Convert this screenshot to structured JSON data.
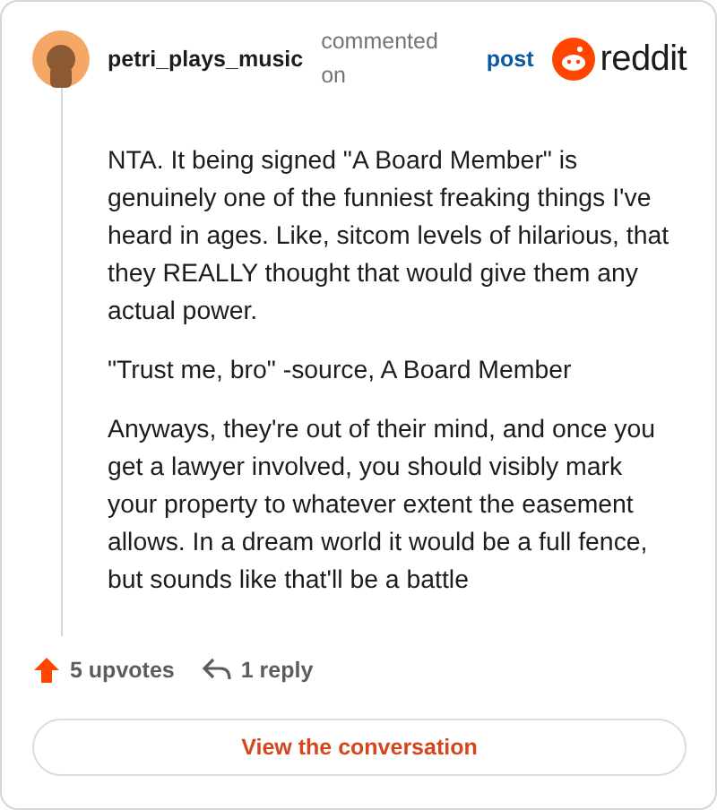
{
  "header": {
    "username": "petri_plays_music",
    "action": "commented on",
    "link": "post",
    "logo_text": "reddit"
  },
  "comment": {
    "paragraphs": [
      "NTA. It being signed \"A Board Member\" is genuinely one of the funniest freaking things I've heard in ages. Like, sitcom levels of hilarious, that they REALLY thought that would give them any actual power.",
      "\"Trust me, bro\" -source, A Board Member",
      "Anyways, they're out of their mind, and once you get a lawyer involved, you should visibly mark your property to whatever extent the easement allows. In a dream world it would be a full fence, but sounds like that'll be a battle"
    ]
  },
  "footer": {
    "upvotes": "5 upvotes",
    "replies": "1 reply",
    "button": "View the conversation"
  }
}
